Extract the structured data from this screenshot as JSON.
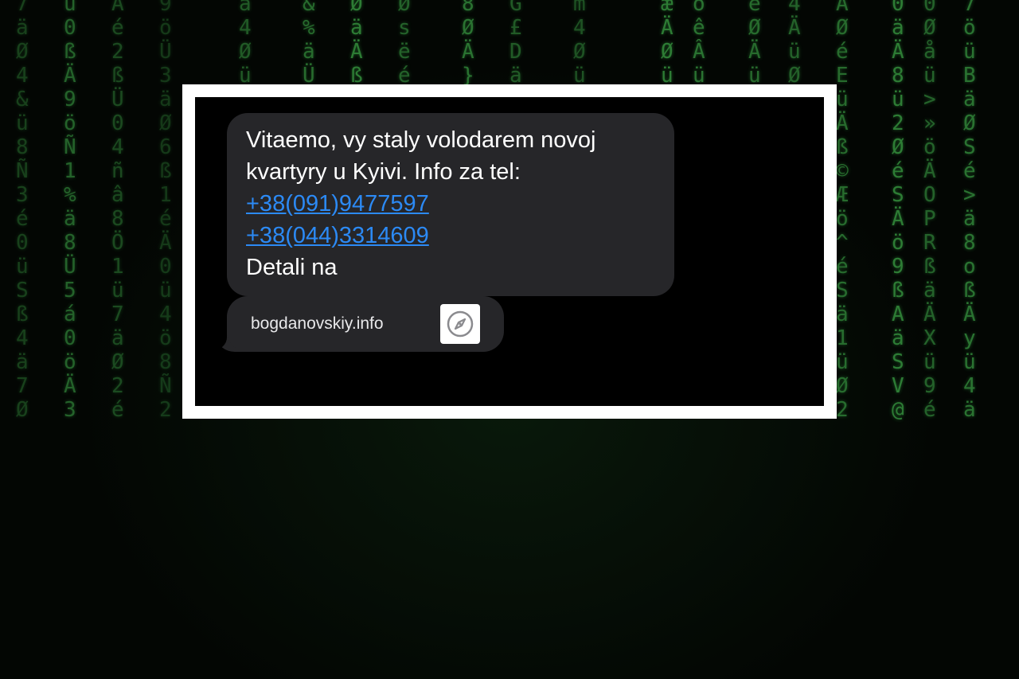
{
  "message": {
    "line1": "Vitaemo, vy staly volodarem novoj",
    "line2": "kvartyry u Kyivi. Info za tel:",
    "phone1": "+38(091)9477597",
    "phone2": "+38(044)3314609",
    "line3": "Detali na"
  },
  "link_preview": {
    "domain": "bogdanovskiy.info",
    "icon": "compass-icon"
  },
  "colors": {
    "bubble": "#262629",
    "link": "#2c8af5",
    "matrix_green": "#3fae4a"
  }
}
